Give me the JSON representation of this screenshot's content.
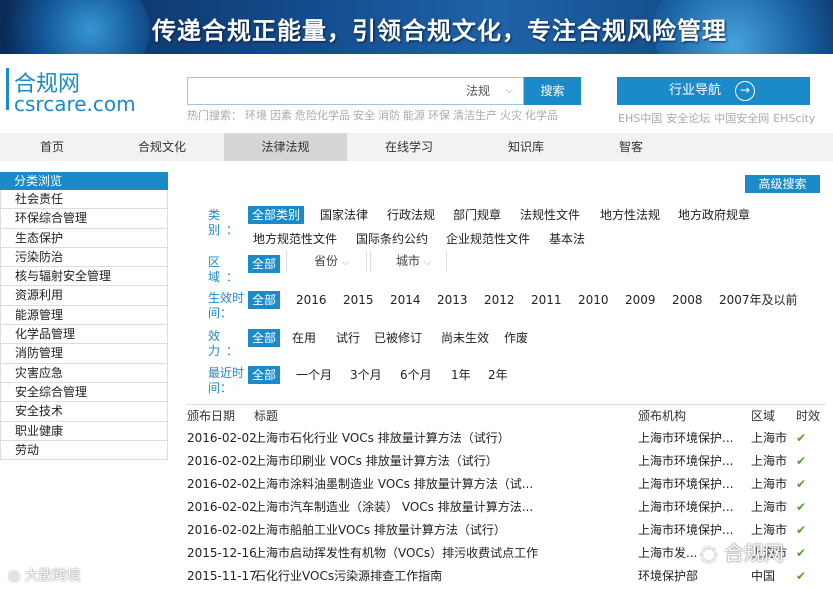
{
  "banner": {
    "slogan": "传递合规正能量，引领合规文化，专注合规风险管理"
  },
  "logo": {
    "cn": "合规网",
    "en": "csrcare.com"
  },
  "search": {
    "placeholder": "",
    "scope": "法规",
    "button": "搜索"
  },
  "hot_searches": {
    "label": "热门搜索：",
    "terms": [
      "环境",
      "因素",
      "危险化学品",
      "安全",
      "消防",
      "能源",
      "环保",
      "清洁生产",
      "火灾",
      "化学品"
    ]
  },
  "industry_nav": {
    "label": "行业导航"
  },
  "partners": [
    "EHS中国",
    "安全论坛",
    "中国安全网",
    "EHScity"
  ],
  "nav": [
    {
      "label": "首页"
    },
    {
      "label": "合规文化"
    },
    {
      "label": "法律法规"
    },
    {
      "label": "在线学习"
    },
    {
      "label": "知识库"
    },
    {
      "label": "智客"
    }
  ],
  "sidebar": {
    "title": "分类浏览",
    "items": [
      "社会责任",
      "环保综合管理",
      "生态保护",
      "污染防治",
      "核与辐射安全管理",
      "资源利用",
      "能源管理",
      "化学品管理",
      "消防管理",
      "灾害应急",
      "安全综合管理",
      "安全技术",
      "职业健康",
      "劳动"
    ]
  },
  "advanced_search": "高级搜索",
  "filters": {
    "category": {
      "label": "类别：",
      "all": "全部类别",
      "options": [
        "国家法律",
        "行政法规",
        "部门规章",
        "法规性文件",
        "地方性法规",
        "地方政府规章",
        "地方规范性文件",
        "国际条约公约",
        "企业规范性文件",
        "基本法"
      ]
    },
    "region": {
      "label": "区域：",
      "all": "全部",
      "province": "省份",
      "city": "城市"
    },
    "effective_time": {
      "label": "生效时间：",
      "all": "全部",
      "options": [
        "2016",
        "2015",
        "2014",
        "2013",
        "2012",
        "2011",
        "2010",
        "2009",
        "2008",
        "2007年及以前"
      ]
    },
    "validity": {
      "label": "效力：",
      "all": "全部",
      "options": [
        "在用",
        "试行",
        "已被修订",
        "尚未生效",
        "作废"
      ]
    },
    "recent": {
      "label": "最近时间：",
      "all": "全部",
      "options": [
        "一个月",
        "3个月",
        "6个月",
        "1年",
        "2年"
      ]
    }
  },
  "table": {
    "headers": {
      "date": "颁布日期",
      "title": "标题",
      "org": "颁布机构",
      "area": "区域",
      "eff": "时效"
    },
    "rows": [
      {
        "date": "2016-02-02",
        "title": "上海市石化行业 VOCs 排放量计算方法（试行）",
        "org": "上海市环境保护...",
        "area": "上海市",
        "eff": "✔"
      },
      {
        "date": "2016-02-02",
        "title": "上海市印刷业 VOCs 排放量计算方法（试行）",
        "org": "上海市环境保护...",
        "area": "上海市",
        "eff": "✔"
      },
      {
        "date": "2016-02-02",
        "title": "上海市涂料油墨制造业 VOCs 排放量计算方法（试...",
        "org": "上海市环境保护...",
        "area": "上海市",
        "eff": "✔"
      },
      {
        "date": "2016-02-02",
        "title": "上海市汽车制造业（涂装） VOCs 排放量计算方法...",
        "org": "上海市环境保护...",
        "area": "上海市",
        "eff": "✔"
      },
      {
        "date": "2016-02-02",
        "title": "上海市船舶工业VOCs 排放量计算方法（试行）",
        "org": "上海市环境保护...",
        "area": "上海市",
        "eff": "✔"
      },
      {
        "date": "2015-12-16",
        "title": "上海市启动挥发性有机物（VOCs）排污收费试点工作",
        "org": "上海市发...",
        "area": "上海市",
        "eff": "✔"
      },
      {
        "date": "2015-11-17",
        "title": "石化行业VOCs污染源排查工作指南",
        "org": "环境保护部",
        "area": "中国",
        "eff": "✔"
      }
    ]
  },
  "watermarks": {
    "left": "大散跨境",
    "right": "合规网"
  }
}
